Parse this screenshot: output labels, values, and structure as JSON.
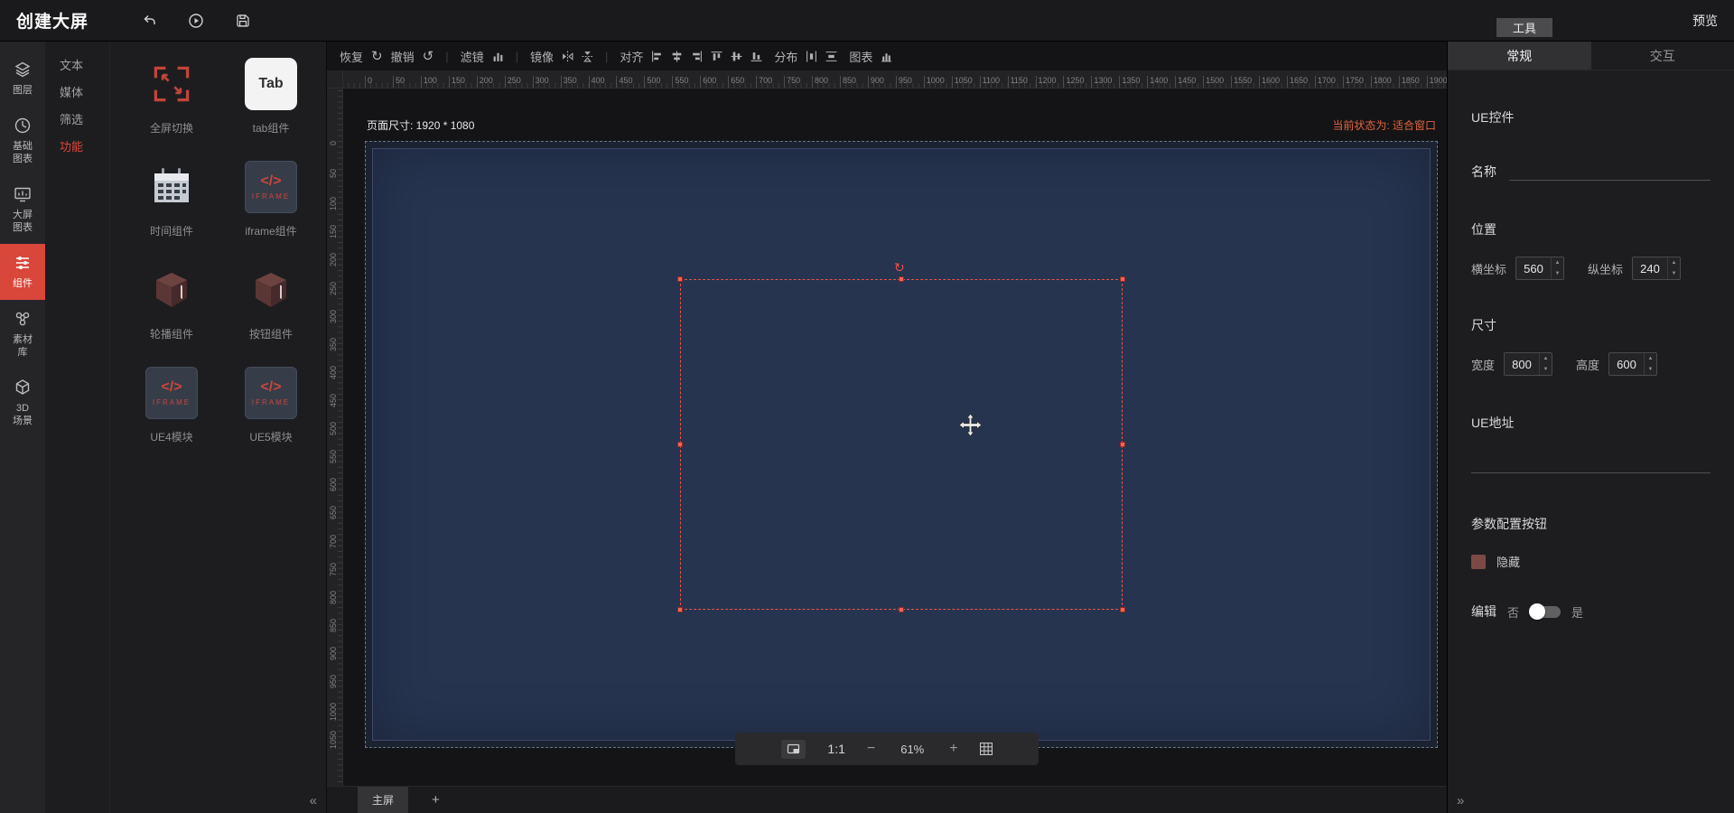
{
  "topbar": {
    "title": "创建大屏",
    "preview": "预览",
    "tools": "工具"
  },
  "sidebar": {
    "items": [
      {
        "label": "图层"
      },
      {
        "label": "基础图表"
      },
      {
        "label": "大屏图表"
      },
      {
        "label": "组件"
      },
      {
        "label": "素材库"
      },
      {
        "label": "3D场景"
      }
    ]
  },
  "categories": {
    "items": [
      {
        "label": "文本"
      },
      {
        "label": "媒体"
      },
      {
        "label": "筛选"
      },
      {
        "label": "功能"
      }
    ]
  },
  "components": {
    "items": [
      {
        "label": "全屏切换"
      },
      {
        "label": "tab组件",
        "tab_text": "Tab"
      },
      {
        "label": "时间组件"
      },
      {
        "label": "iframe组件",
        "code": "</>",
        "tag": "IFRAME"
      },
      {
        "label": "轮播组件"
      },
      {
        "label": "按钮组件"
      },
      {
        "label": "UE4模块",
        "code": "</>",
        "tag": "IFRAME"
      },
      {
        "label": "UE5模块",
        "code": "</>",
        "tag": "IFRAME"
      }
    ]
  },
  "toolbar": {
    "restore": "恢复",
    "undo": "撤销",
    "filter": "滤镜",
    "mirror": "镜像",
    "align": "对齐",
    "distribute": "分布",
    "chart": "图表",
    "redo_glyph": "↻",
    "undo_glyph": "↺"
  },
  "canvas": {
    "page_size_label": "页面尺寸: 1920 * 1080",
    "status_label": "当前状态为: 适合窗口",
    "ratio": "1:1",
    "zoom": "61%",
    "minus": "−",
    "plus": "+",
    "screen_tab": "主屏",
    "add_tab": "+",
    "collapse": "«",
    "expand": "»",
    "rotate_glyph": "↻"
  },
  "rulers": {
    "horizontal": {
      "start": 0,
      "end": 1900,
      "step": 50
    },
    "vertical": {
      "start": 0,
      "end": 1050,
      "step": 50
    }
  },
  "inspector": {
    "tab_general": "常规",
    "tab_interact": "交互",
    "ue_control": "UE控件",
    "name_label": "名称",
    "position_label": "位置",
    "x_label": "横坐标",
    "x_value": "560",
    "y_label": "纵坐标",
    "y_value": "240",
    "size_label": "尺寸",
    "w_label": "宽度",
    "w_value": "800",
    "h_label": "高度",
    "h_value": "600",
    "ue_address_label": "UE地址",
    "param_button_label": "参数配置按钮",
    "hide_label": "隐藏",
    "edit_label": "编辑",
    "edit_no": "否",
    "edit_yes": "是"
  }
}
